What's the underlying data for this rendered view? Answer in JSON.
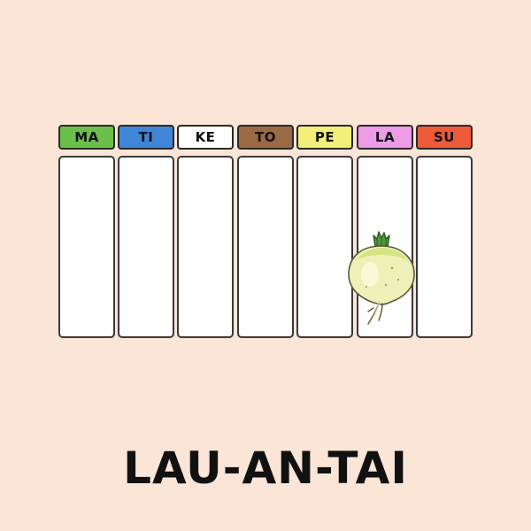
{
  "days": [
    {
      "label": "MA",
      "color": "#6cc04a"
    },
    {
      "label": "TI",
      "color": "#3f86d9"
    },
    {
      "label": "KE",
      "color": "#ffffff"
    },
    {
      "label": "TO",
      "color": "#9a6a45"
    },
    {
      "label": "PE",
      "color": "#f2ef7a"
    },
    {
      "label": "LA",
      "color": "#ee9be8"
    },
    {
      "label": "SU",
      "color": "#ee5a3a"
    }
  ],
  "title": "LAU-AN-TAI",
  "background_color": "#fbe5d6",
  "decoration": {
    "icon": "turnip-icon",
    "day": "LA"
  }
}
